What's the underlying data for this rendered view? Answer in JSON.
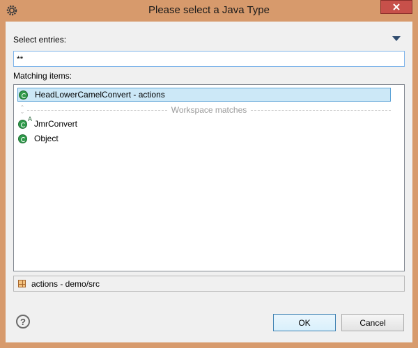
{
  "window": {
    "title": "Please select a Java Type",
    "icons": {
      "app": "gear-icon",
      "close": "close-icon"
    }
  },
  "filter": {
    "label": "Select entries:",
    "value": "**",
    "menu_icon": "chevron-down-icon"
  },
  "results": {
    "label": "Matching items:",
    "history_items": [
      {
        "name": "HeadLowerCamelConvert - actions",
        "icon": "class-icon",
        "selected": true
      }
    ],
    "separator_label": "Workspace matches",
    "workspace_items": [
      {
        "name": "JmrConvert",
        "icon": "abstract-class-icon",
        "badge": "A"
      },
      {
        "name": "Object",
        "icon": "class-icon"
      }
    ]
  },
  "details": {
    "text": "actions - demo/src",
    "icon": "package-icon"
  },
  "buttons": {
    "help_glyph": "?",
    "ok": "OK",
    "cancel": "Cancel"
  },
  "colors": {
    "title_bar": "#d79a6c",
    "dialog_bg": "#f0f0f0",
    "selection_bg": "#cce8f7",
    "selection_border": "#5aa2d6",
    "class_icon": "#2f9a4a",
    "close_button": "#c7504a"
  }
}
